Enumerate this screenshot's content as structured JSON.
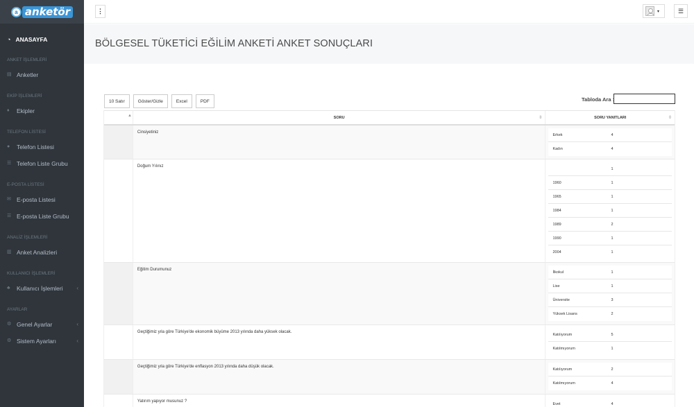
{
  "app": {
    "logo_text": "anketör",
    "logo_glyph": "a"
  },
  "sidebar": {
    "home": {
      "label": "ANASAYFA",
      "icon": "speedometer-icon"
    },
    "sections": [
      {
        "heading": "ANKET İŞLEMLERİ",
        "items": [
          {
            "label": "Anketler",
            "icon": "docs-icon"
          }
        ]
      },
      {
        "heading": "EKİP İŞLEMLERİ",
        "items": [
          {
            "label": "Ekipler",
            "icon": "pin-icon"
          }
        ]
      },
      {
        "heading": "TELEFON LİSTESİ",
        "items": [
          {
            "label": "Telefon Listesi",
            "icon": "user-icon"
          },
          {
            "label": "Telefon Liste Grubu",
            "icon": "list-icon"
          }
        ]
      },
      {
        "heading": "E-POSTA LİSTESİ",
        "items": [
          {
            "label": "E-posta Listesi",
            "icon": "envelope-icon"
          },
          {
            "label": "E-posta Liste Grubu",
            "icon": "list-icon"
          }
        ]
      },
      {
        "heading": "ANALİZ İŞLEMLERİ",
        "items": [
          {
            "label": "Anket Analizleri",
            "icon": "bar-chart-icon"
          }
        ]
      },
      {
        "heading": "KULLANICI İŞLEMLERİ",
        "items": [
          {
            "label": "Kullanıcı İşlemleri",
            "icon": "users-icon",
            "arrow": "‹"
          }
        ]
      },
      {
        "heading": "AYARLAR",
        "items": [
          {
            "label": "Genel Ayarlar",
            "icon": "gears-icon",
            "arrow": "‹"
          },
          {
            "label": "Sistem Ayarları",
            "icon": "gears-icon",
            "arrow": "‹"
          }
        ]
      }
    ]
  },
  "header": {
    "dots": "⋮",
    "caret": "▾",
    "menu": "☰"
  },
  "page": {
    "title": "BÖLGESEL TÜKETİCİ EĞİLİM ANKETİ ANKET SONUÇLARI"
  },
  "toolbar": {
    "rows": "10 Satır",
    "toggle": "Göster/Gizle",
    "excel": "Excel",
    "pdf": "PDF",
    "search_label": "Tabloda Ara :",
    "search_value": ""
  },
  "table": {
    "headers": [
      "",
      "SORU",
      "SORU YANITLARI"
    ],
    "rows": [
      {
        "question": "Cinsiyetiniz",
        "answers": [
          {
            "label": "Erkek",
            "value": "4"
          },
          {
            "label": "Kadın",
            "value": "4"
          }
        ]
      },
      {
        "question": "Doğum Yılınız",
        "answers": [
          {
            "label": "",
            "value": "1"
          },
          {
            "label": "1960",
            "value": "1"
          },
          {
            "label": "1965",
            "value": "1"
          },
          {
            "label": "1984",
            "value": "1"
          },
          {
            "label": "1989",
            "value": "2"
          },
          {
            "label": "1990",
            "value": "1"
          },
          {
            "label": "2004",
            "value": "1"
          }
        ]
      },
      {
        "question": "Eğitim Durumunuz",
        "answers": [
          {
            "label": "İlkokul",
            "value": "1"
          },
          {
            "label": "Lise",
            "value": "1"
          },
          {
            "label": "Üniversite",
            "value": "3"
          },
          {
            "label": "Yüksek Lisans",
            "value": "2"
          }
        ]
      },
      {
        "question": "Geçtiğimiz yıla göre Türkiye'de ekonomik büyüme 2013 yılında daha yüksek olacak.",
        "answers": [
          {
            "label": "Katılıyorum",
            "value": "5"
          },
          {
            "label": "Katılmıyorum",
            "value": "1"
          }
        ]
      },
      {
        "question": "Geçtiğimiz yıla göre Türkiye'de enflasyon 2013 yılında daha düşük olacak.",
        "answers": [
          {
            "label": "Katılıyorum",
            "value": "2"
          },
          {
            "label": "Katılmıyorum",
            "value": "4"
          }
        ]
      },
      {
        "question": "Yatırım yapıyor musunuz ?",
        "answers": [
          {
            "label": "Evet",
            "value": "4"
          }
        ]
      }
    ]
  }
}
